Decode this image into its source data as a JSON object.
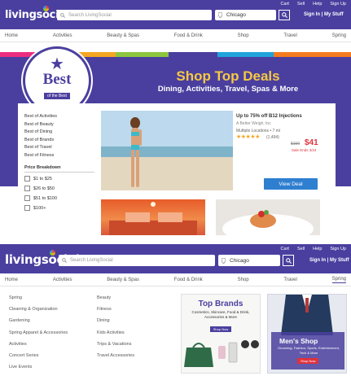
{
  "brand": {
    "name": "livingsocial",
    "color": "#4a3f9f",
    "accent_red": "#e0313b",
    "accent_gold": "#f7c942"
  },
  "header": {
    "util_links": [
      "Cart",
      "Sell",
      "Help",
      "Sign Up"
    ],
    "search_placeholder": "Search LivingSocial",
    "location": "Chicago",
    "signin": "Sign In | My Stuff"
  },
  "nav": [
    "Home",
    "Activities",
    "Beauty & Spas",
    "Food & Drink",
    "Shop",
    "Travel",
    "Spring"
  ],
  "hero": {
    "badge_best": "Best",
    "badge_ribbon": "of the Best",
    "title": "Shop Top Deals",
    "subtitle": "Dining, Activities, Travel, Spas & More"
  },
  "categories": [
    "Best of Activities",
    "Best of Beauty",
    "Best of Dining",
    "Best of Brands",
    "Best of Travel",
    "Best of Fitness"
  ],
  "price_breakdown": {
    "title": "Price Breakdown",
    "options": [
      "$1 to $25",
      "$26 to $50",
      "$51 to $100",
      "$100+"
    ]
  },
  "featured_deal": {
    "title": "Up to 75% off B12 Injections",
    "merchant": "A Better Weigh, Inc",
    "location": "Multiple Locations • 7 mi",
    "rating": 4.5,
    "stars": "★★★★★",
    "review_count": "(1,494)",
    "original_price": "$150",
    "price": "$41",
    "ends": "Sale Ends 3/24",
    "cta": "View Deal"
  },
  "spring_menu": {
    "col1": [
      "Spring",
      "Cleaning & Organization",
      "Gardening",
      "Spring Apparel & Accessories",
      "Activities",
      "Concert Series",
      "Live Events"
    ],
    "col2": [
      "Beauty",
      "Fitness",
      "Dining",
      "Kids Activities",
      "Trips & Vacations",
      "Travel Accessories"
    ],
    "promo_brands": {
      "title": "Top Brands",
      "subtitle": "Cosmetics, Skincare, Food & Drink, Accessories & More",
      "button": "Shop Now"
    },
    "promo_mens": {
      "title": "Men's Shop",
      "subtitle": "Grooming, Fashion, Sports, Entertainment, Tech & More",
      "button": "Shop Now"
    }
  }
}
